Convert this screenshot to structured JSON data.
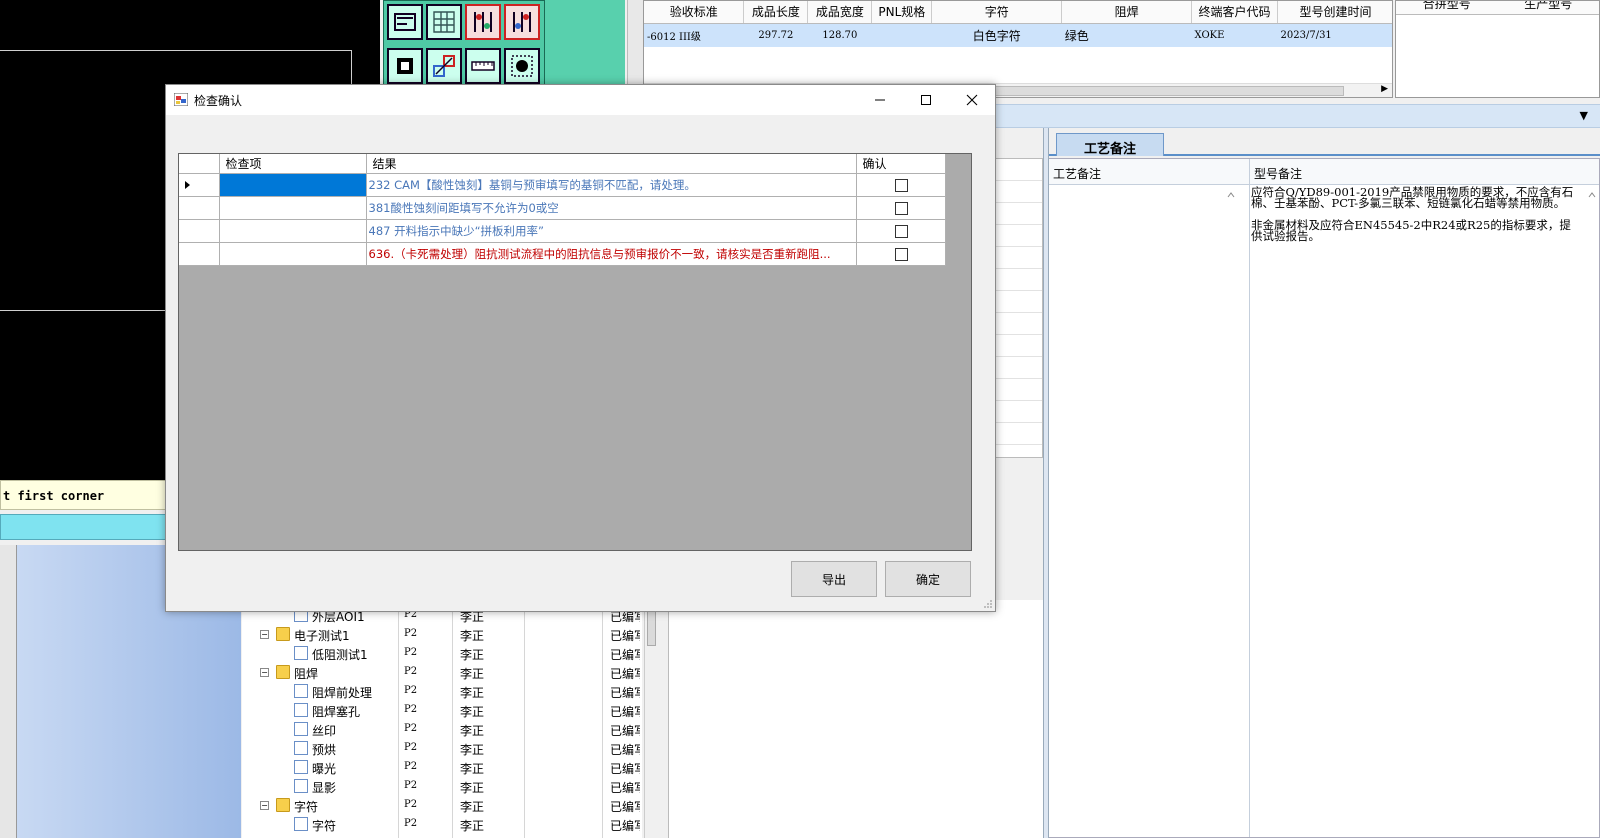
{
  "cad": {
    "status_text": "t first corner"
  },
  "top_grid": {
    "columns": [
      "验收标准",
      "成品长度",
      "成品宽度",
      "PNL规格",
      "字符",
      "阻焊",
      "终端客户代码",
      "型号创建时间"
    ],
    "row": [
      "-6012 III级",
      "297.72",
      "128.70",
      "",
      "白色字符",
      "绿色",
      "XOKE",
      "2023/7/31"
    ]
  },
  "top_right_grid": {
    "columns": [
      "合拼型号",
      "生产型号"
    ]
  },
  "notes_panel": {
    "tab_label": "工艺备注",
    "col1_header": "工艺备注",
    "col2_header": "型号备注",
    "note_text": "应符合Q/YD89-001-2019产品禁限用物质的要求，不应含有石棉、壬基苯酚、PCT-多氯三联苯、短链氯化石蜡等禁用物质。\n\n非金属材料及应符合EN45545-2中R24或R25的指标要求，提供试验报告。"
  },
  "tree": {
    "rows": [
      {
        "name": "外层AOI1",
        "c2": "P2",
        "c3": "李正",
        "c5": "已编写",
        "type": "file"
      },
      {
        "name": "电子测试1",
        "c2": "P2",
        "c3": "李正",
        "c5": "已编写",
        "type": "folder"
      },
      {
        "name": "低阻测试1",
        "c2": "P2",
        "c3": "李正",
        "c5": "已编写",
        "type": "file"
      },
      {
        "name": "阻焊",
        "c2": "P2",
        "c3": "李正",
        "c5": "已编写",
        "type": "folder"
      },
      {
        "name": "阻焊前处理",
        "c2": "P2",
        "c3": "李正",
        "c5": "已编写",
        "type": "file"
      },
      {
        "name": "阻焊塞孔",
        "c2": "P2",
        "c3": "李正",
        "c5": "已编写",
        "type": "file"
      },
      {
        "name": "丝印",
        "c2": "P2",
        "c3": "李正",
        "c5": "已编写",
        "type": "file"
      },
      {
        "name": "预烘",
        "c2": "P2",
        "c3": "李正",
        "c5": "已编写",
        "type": "file"
      },
      {
        "name": "曝光",
        "c2": "P2",
        "c3": "李正",
        "c5": "已编写",
        "type": "file"
      },
      {
        "name": "显影",
        "c2": "P2",
        "c3": "李正",
        "c5": "已编写",
        "type": "file"
      },
      {
        "name": "字符",
        "c2": "P2",
        "c3": "李正",
        "c5": "已编写",
        "type": "folder"
      },
      {
        "name": "字符",
        "c2": "P2",
        "c3": "李正",
        "c5": "已编写",
        "type": "file"
      }
    ]
  },
  "dialog": {
    "title": "检查确认",
    "columns": {
      "item": "检查项",
      "result": "结果",
      "confirm": "确认"
    },
    "rows": [
      {
        "item": "",
        "result": "232 CAM【酸性蚀刻】基铜与预审填写的基铜不匹配，请处理。",
        "style": "blue",
        "checked": false
      },
      {
        "item": "",
        "result": "381酸性蚀刻间距填写不允许为0或空",
        "style": "blue",
        "checked": false
      },
      {
        "item": "",
        "result": "487 开料指示中缺少“拼板利用率”",
        "style": "blue",
        "checked": false
      },
      {
        "item": "",
        "result": "636.（卡死需处理）阻抗测试流程中的阻抗信息与预审报价不一致，请核实是否重新跑阻...",
        "style": "red",
        "checked": false
      }
    ],
    "export_label": "导出",
    "ok_label": "确定"
  },
  "colors": {
    "selection": "#0078d7",
    "result_blue": "#4a77b8",
    "result_red": "#c00000",
    "grid_empty": "#ababab",
    "toolbar_green": "#4fc9a5"
  }
}
